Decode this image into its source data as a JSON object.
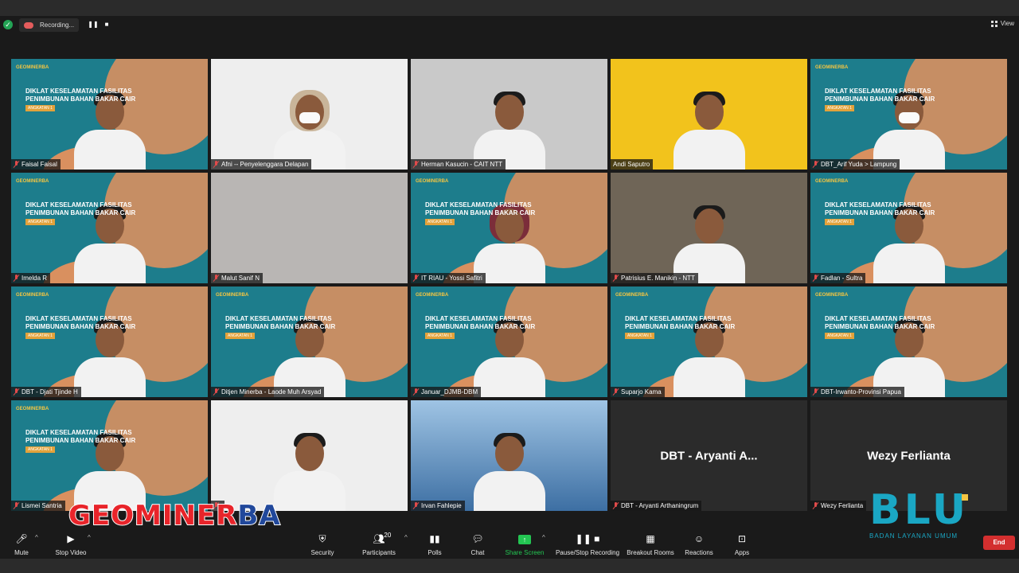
{
  "window": {
    "recording_label": "Recording...",
    "view_label": "View"
  },
  "slide": {
    "brand": "GEOMINERBA",
    "title": "DIKLAT KESELAMATAN FASILITAS PENIMBUNAN BAHAN BAKAR CAIR",
    "badge": "ANGKATAN 1"
  },
  "participants": [
    {
      "name": "Faisal Faisal",
      "bg": "slide",
      "muted": true
    },
    {
      "name": "Afni -- Penyelenggara Delapan",
      "bg": "white",
      "muted": true,
      "active": true
    },
    {
      "name": "Herman Kasucin - CAIT  NTT",
      "bg": "grey",
      "muted": true
    },
    {
      "name": "Andi Saputro",
      "bg": "yellow",
      "muted": false
    },
    {
      "name": "DBT_Arif Yuda > Lampung",
      "bg": "slide",
      "muted": true
    },
    {
      "name": "Imelda R",
      "bg": "slide",
      "muted": true
    },
    {
      "name": "Malut Sanif N",
      "bg": "blank",
      "muted": true
    },
    {
      "name": "IT RIAU - Yossi Safitri",
      "bg": "slide",
      "muted": true
    },
    {
      "name": "Patrisius E. Manikin - NTT",
      "bg": "room",
      "muted": true
    },
    {
      "name": "Fadlan - Sultra",
      "bg": "slide",
      "muted": true
    },
    {
      "name": "DBT - Djati Tjinde H",
      "bg": "slide",
      "muted": true
    },
    {
      "name": "Ditjen Minerba - Laode Muh Arsyad",
      "bg": "slide",
      "muted": true
    },
    {
      "name": "Januar_DJMB-DBM",
      "bg": "slide",
      "muted": true
    },
    {
      "name": "Suparjo Kama",
      "bg": "slide",
      "muted": true
    },
    {
      "name": "DBT-Irwanto-Provinsi Papua",
      "bg": "slide",
      "muted": true
    },
    {
      "name": "Lismei Santria",
      "bg": "slide",
      "muted": true
    },
    {
      "name": "",
      "bg": "white",
      "muted": true
    },
    {
      "name": "Irvan Fahlepie",
      "bg": "city",
      "muted": true
    },
    {
      "name": "DBT - Aryanti Arthaningrum",
      "bg": "dark",
      "muted": true,
      "display": "DBT - Aryanti A..."
    },
    {
      "name": "Wezy Ferlianta",
      "bg": "dark",
      "muted": true,
      "display": "Wezy Ferlianta"
    }
  ],
  "toolbar": {
    "mute": "Mute",
    "stop_video": "Stop Video",
    "security": "Security",
    "participants": "Participants",
    "participants_count": "20",
    "polls": "Polls",
    "chat": "Chat",
    "share_screen": "Share Screen",
    "pause_recording": "Pause/Stop Recording",
    "breakout_rooms": "Breakout Rooms",
    "reactions": "Reactions",
    "apps": "Apps",
    "end": "End"
  },
  "overlays": {
    "geominerba_left": "GEO",
    "geominerba_mid": "MINER",
    "geominerba_right": "BA",
    "blu_letters": "BLU",
    "blu_sub": "BADAN LAYANAN UMUM"
  }
}
